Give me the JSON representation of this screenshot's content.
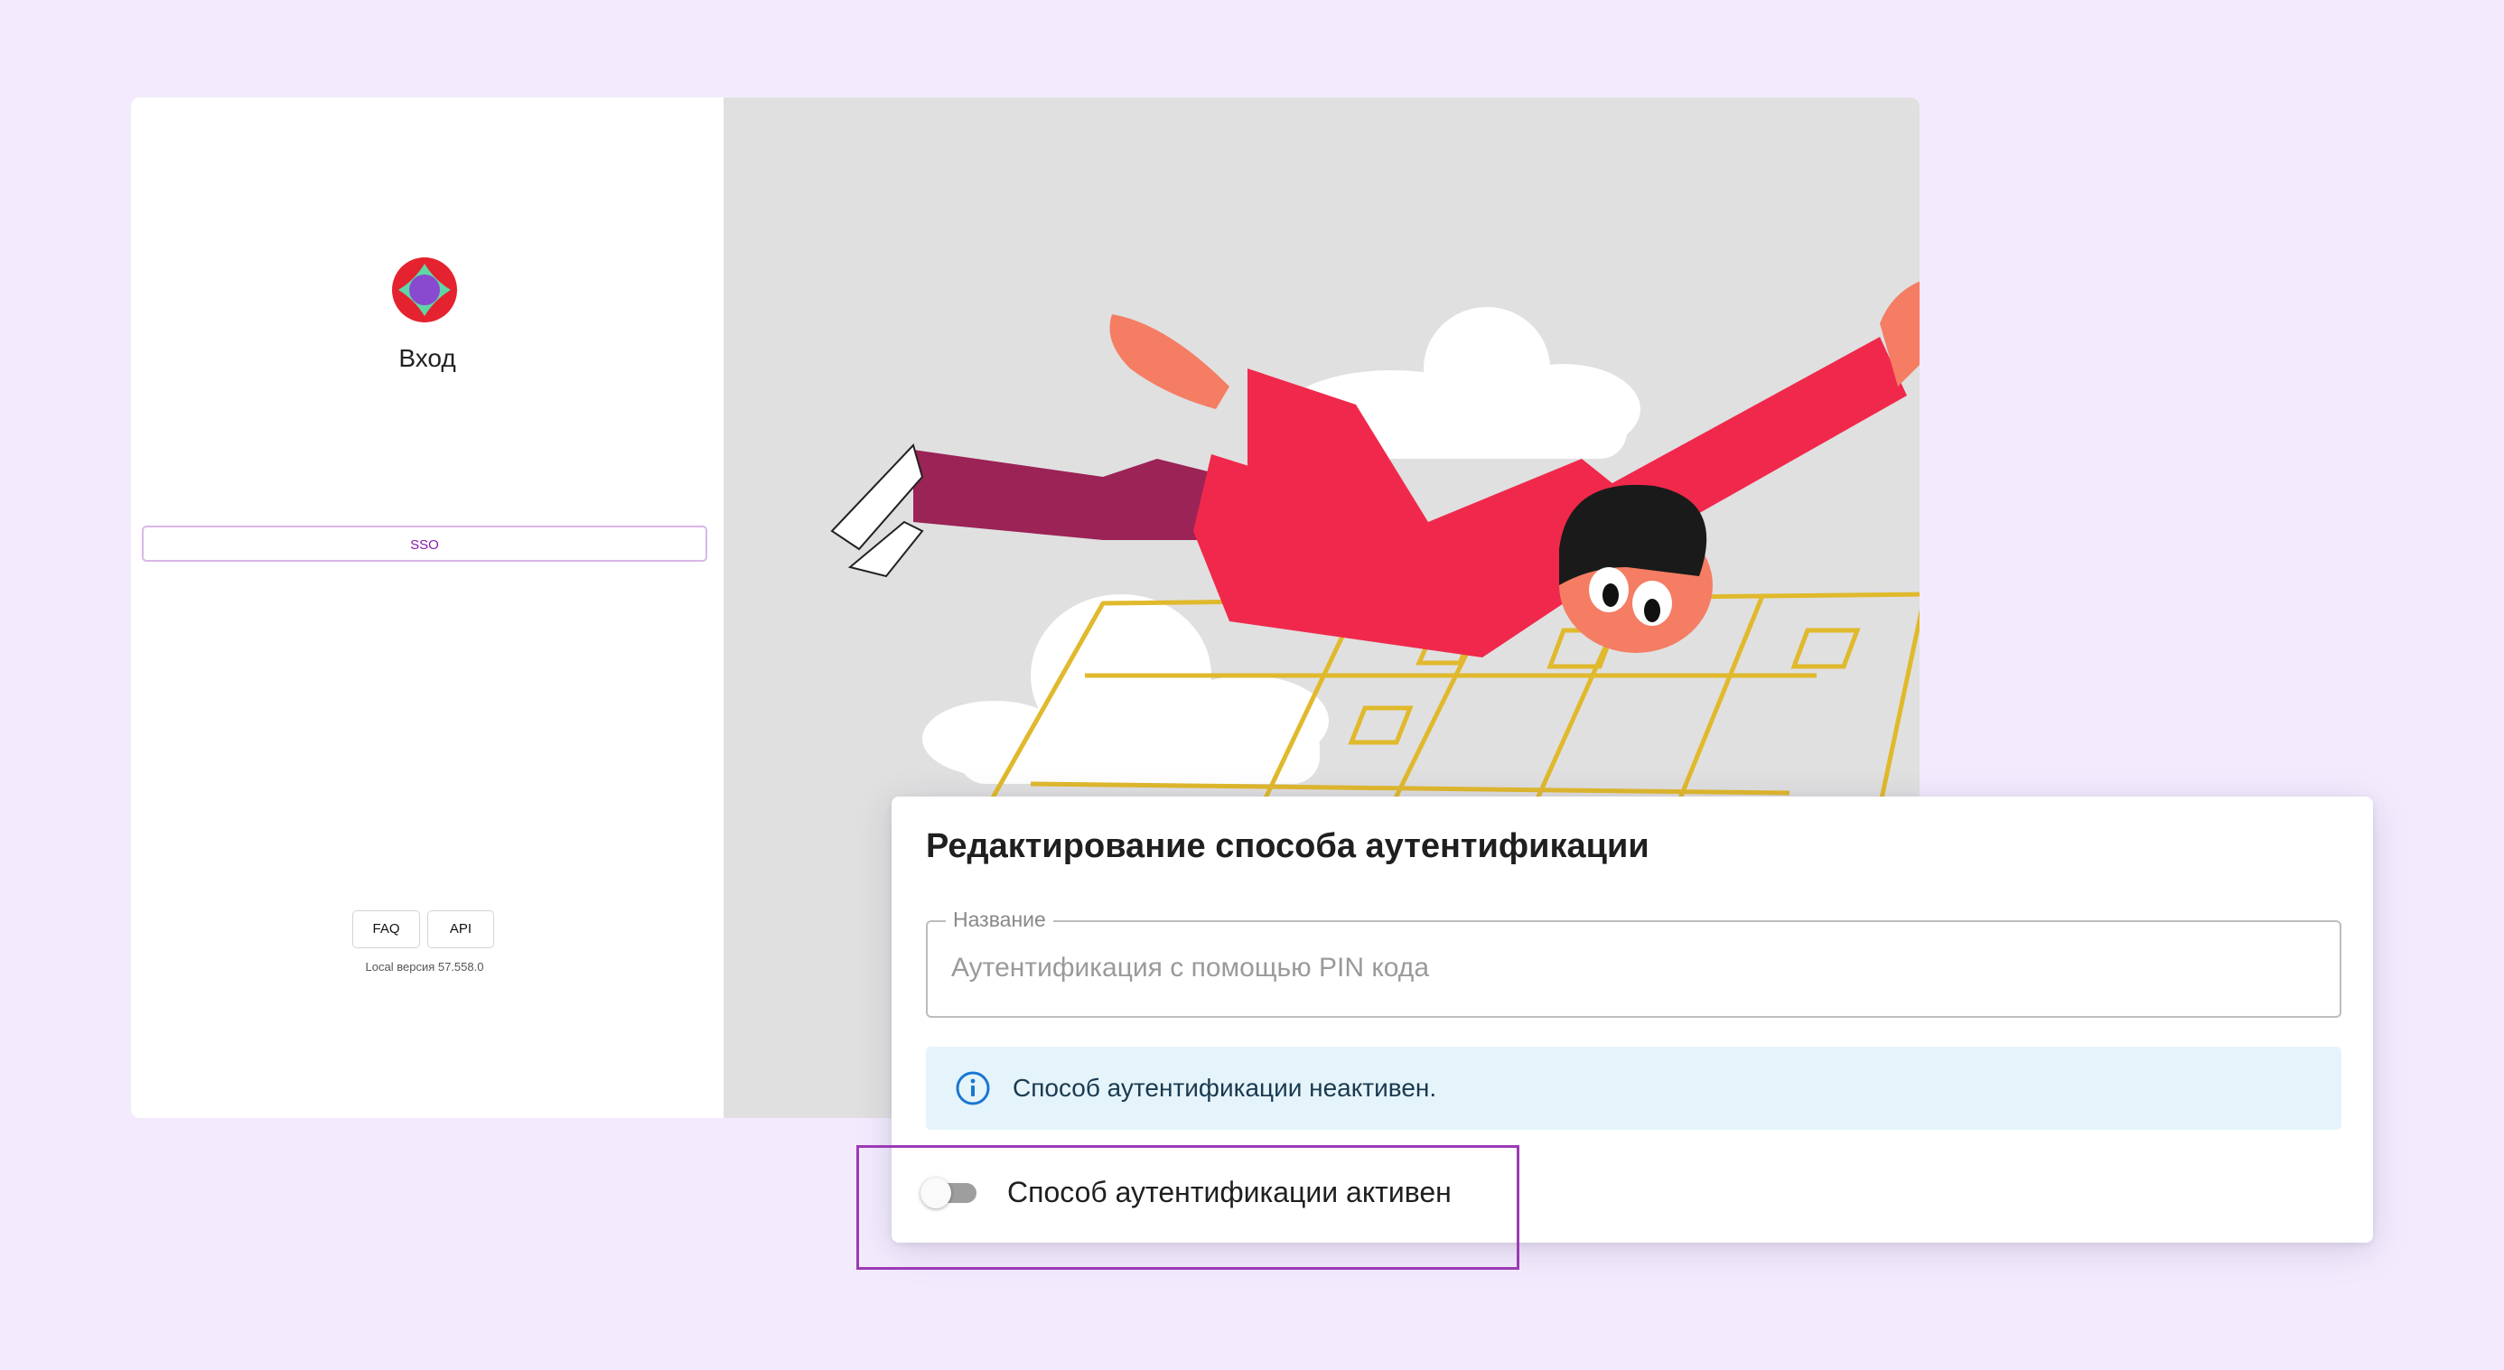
{
  "login": {
    "title": "Вход",
    "sso_button": "SSO",
    "faq_button": "FAQ",
    "api_button": "API",
    "version": "Local версия 57.558.0",
    "logo_icon": "logo-icon"
  },
  "dialog": {
    "title": "Редактирование способа аутентификации",
    "name_field": {
      "label": "Название",
      "value": "Аутентификация с помощью PIN кода"
    },
    "alert": {
      "icon": "info-icon",
      "text": "Способ аутентификации неактивен."
    },
    "toggle": {
      "label": "Способ аутентификации активен",
      "checked": false
    }
  },
  "colors": {
    "background": "#f3ebfd",
    "accent": "#9c3ab6",
    "sso_text": "#8a1ab0",
    "alert_bg": "#e5f4fb",
    "info_icon": "#1976d2",
    "illustration_red": "#f0294c",
    "illustration_yellow": "#e0b92c"
  }
}
